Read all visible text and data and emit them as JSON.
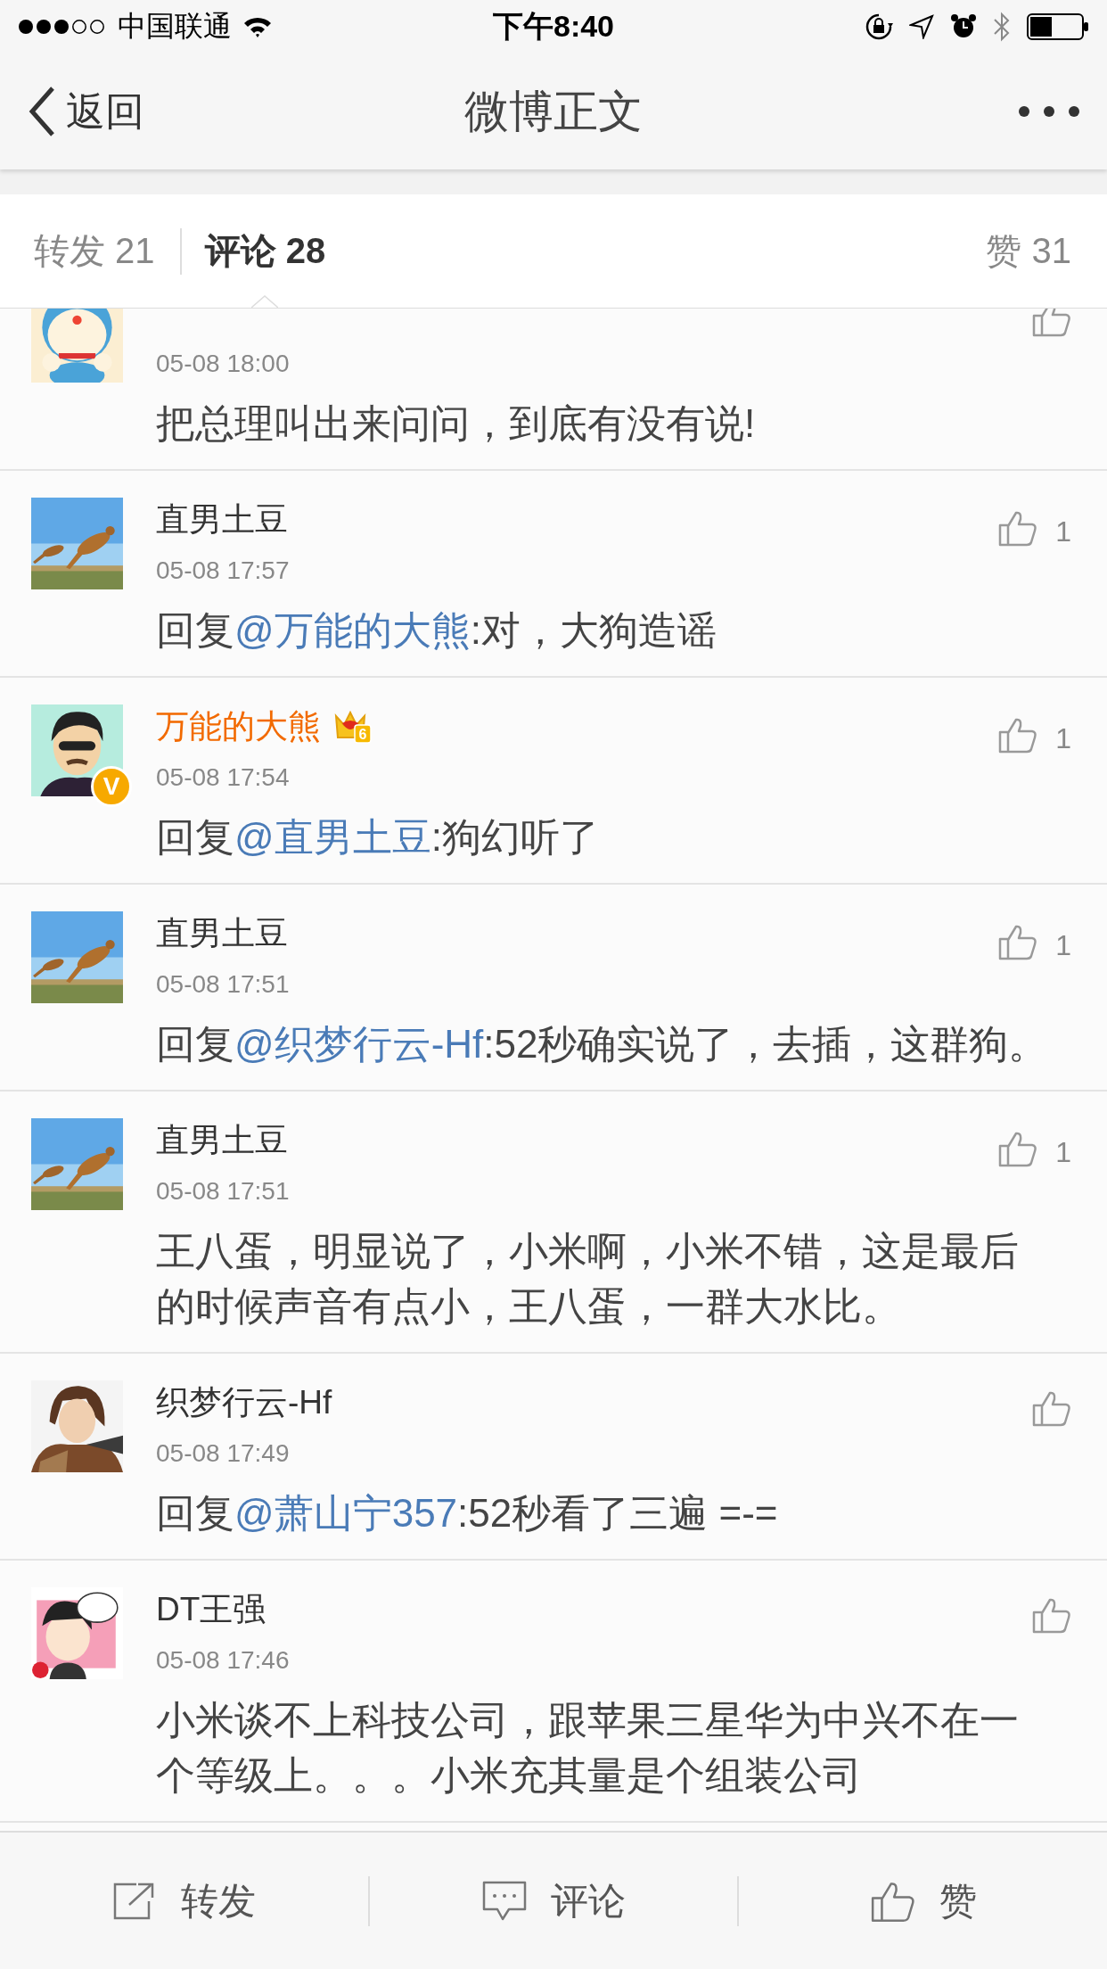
{
  "status_bar": {
    "carrier": "中国联通",
    "time": "下午8:40"
  },
  "nav": {
    "back": "返回",
    "title": "微博正文"
  },
  "tabs": [
    {
      "label": "转发 21",
      "selected": false
    },
    {
      "label": "评论 28",
      "selected": true
    },
    {
      "label": "赞 31",
      "selected": false
    }
  ],
  "comments": [
    {
      "date": "05-08 18:00",
      "text": [
        {
          "kind": "plain",
          "text": "把总理叫出来问问，到底有没有说!"
        }
      ]
    },
    {
      "name": "直男土豆",
      "member": false,
      "date": "05-08 17:57",
      "likes": "1",
      "text": [
        {
          "kind": "plain",
          "text": "回复"
        },
        {
          "kind": "mention",
          "text": "@万能的大熊"
        },
        {
          "kind": "plain",
          "text": ":对，大狗造谣"
        }
      ]
    },
    {
      "name": "万能的大熊",
      "member": true,
      "member_level": "6",
      "verified_badge": "V",
      "date": "05-08 17:54",
      "likes": "1",
      "text": [
        {
          "kind": "plain",
          "text": "回复"
        },
        {
          "kind": "mention",
          "text": "@直男土豆"
        },
        {
          "kind": "plain",
          "text": ":狗幻听了"
        }
      ]
    },
    {
      "name": "直男土豆",
      "member": false,
      "date": "05-08 17:51",
      "likes": "1",
      "text": [
        {
          "kind": "plain",
          "text": "回复"
        },
        {
          "kind": "mention",
          "text": "@织梦行云-Hf"
        },
        {
          "kind": "plain",
          "text": ":52秒确实说了，去插，这群狗。"
        }
      ]
    },
    {
      "name": "直男土豆",
      "member": false,
      "date": "05-08 17:51",
      "likes": "1",
      "text": [
        {
          "kind": "plain",
          "text": "王八蛋，明显说了，小米啊，小米不错，这是最后的时候声音有点小，王八蛋，一群大水比。"
        }
      ]
    },
    {
      "name": "织梦行云-Hf",
      "member": false,
      "date": "05-08 17:49",
      "text": [
        {
          "kind": "plain",
          "text": "回复"
        },
        {
          "kind": "mention",
          "text": "@萧山宁357"
        },
        {
          "kind": "plain",
          "text": ":52秒看了三遍 =-="
        }
      ]
    },
    {
      "name": "DT王强",
      "member": false,
      "date": "05-08 17:46",
      "text": [
        {
          "kind": "plain",
          "text": "小米谈不上科技公司，跟苹果三星华为中兴不在一个等级上。。。小米充其量是个组装公司"
        }
      ]
    }
  ],
  "toolbar": [
    {
      "kind": "share",
      "label": "转发"
    },
    {
      "kind": "comment",
      "label": "评论"
    },
    {
      "kind": "like",
      "label": "赞"
    }
  ]
}
